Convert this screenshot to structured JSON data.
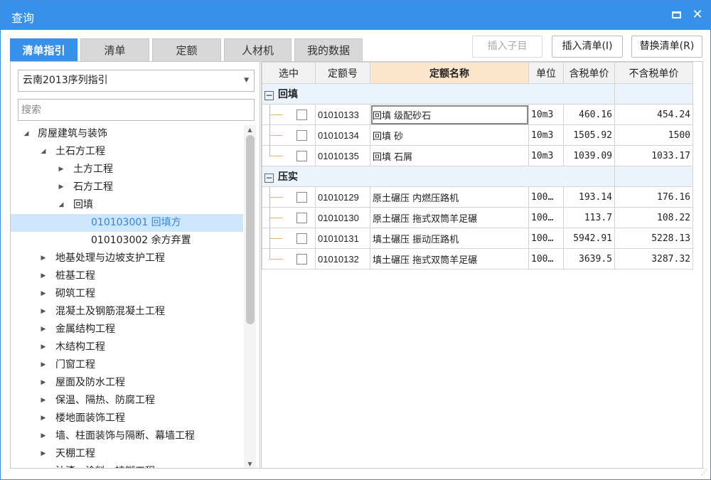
{
  "window": {
    "title": "查询",
    "maximize_icon": "maximize-icon",
    "close_label": "✕"
  },
  "tabs": [
    "清单指引",
    "清单",
    "定额",
    "人材机",
    "我的数据"
  ],
  "buttons": {
    "insert_child": "插入子目",
    "insert_list": "插入清单(I)",
    "replace_list": "替换清单(R)"
  },
  "left": {
    "region_select": "云南2013序列指引",
    "search_placeholder": "搜索",
    "tree": [
      {
        "label": "房屋建筑与装饰",
        "toggle": "◢",
        "level": 0
      },
      {
        "label": "土石方工程",
        "toggle": "◢",
        "level": 1
      },
      {
        "label": "土方工程",
        "toggle": "▶",
        "level": 2
      },
      {
        "label": "石方工程",
        "toggle": "▶",
        "level": 2
      },
      {
        "label": "回填",
        "toggle": "◢",
        "level": 2
      },
      {
        "label": "010103001  回填方",
        "toggle": "",
        "level": 3,
        "selected": true
      },
      {
        "label": "010103002  余方弃置",
        "toggle": "",
        "level": 3
      },
      {
        "label": "地基处理与边坡支护工程",
        "toggle": "▶",
        "level": 1
      },
      {
        "label": "桩基工程",
        "toggle": "▶",
        "level": 1
      },
      {
        "label": "砌筑工程",
        "toggle": "▶",
        "level": 1
      },
      {
        "label": "混凝土及钢筋混凝土工程",
        "toggle": "▶",
        "level": 1
      },
      {
        "label": "金属结构工程",
        "toggle": "▶",
        "level": 1
      },
      {
        "label": "木结构工程",
        "toggle": "▶",
        "level": 1
      },
      {
        "label": "门窗工程",
        "toggle": "▶",
        "level": 1
      },
      {
        "label": "屋面及防水工程",
        "toggle": "▶",
        "level": 1
      },
      {
        "label": "保温、隔热、防腐工程",
        "toggle": "▶",
        "level": 1
      },
      {
        "label": "楼地面装饰工程",
        "toggle": "▶",
        "level": 1
      },
      {
        "label": "墙、柱面装饰与隔断、幕墙工程",
        "toggle": "▶",
        "level": 1
      },
      {
        "label": "天棚工程",
        "toggle": "▶",
        "level": 1
      },
      {
        "label": "油漆、涂料、裱糊工程",
        "toggle": "▶",
        "level": 1
      }
    ]
  },
  "grid": {
    "columns": [
      "选中",
      "定额号",
      "定额名称",
      "单位",
      "含税单价",
      "不含税单价"
    ],
    "groups": [
      {
        "label": "回填",
        "toggle": "−",
        "rows": [
          {
            "code": "01010133",
            "name": "回填  级配砂石",
            "unit": "10m3",
            "price_tax": "460.16",
            "price_notax": "454.24"
          },
          {
            "code": "01010134",
            "name": "回填  砂",
            "unit": "10m3",
            "price_tax": "1505.92",
            "price_notax": "1500"
          },
          {
            "code": "01010135",
            "name": "回填  石屑",
            "unit": "10m3",
            "price_tax": "1039.09",
            "price_notax": "1033.17"
          }
        ]
      },
      {
        "label": "压实",
        "toggle": "−",
        "rows": [
          {
            "code": "01010129",
            "name": "原土碾压  内燃压路机",
            "unit": "100…",
            "price_tax": "193.14",
            "price_notax": "176.16"
          },
          {
            "code": "01010130",
            "name": "原土碾压  拖式双筒羊足碾",
            "unit": "100…",
            "price_tax": "113.7",
            "price_notax": "108.22"
          },
          {
            "code": "01010131",
            "name": "填土碾压  振动压路机",
            "unit": "100…",
            "price_tax": "5942.91",
            "price_notax": "5228.13"
          },
          {
            "code": "01010132",
            "name": "填土碾压  拖式双筒羊足碾",
            "unit": "100…",
            "price_tax": "3639.5",
            "price_notax": "3287.32"
          }
        ]
      }
    ]
  },
  "colors": {
    "accent": "#3790e9",
    "selected_bg": "#cde6fb",
    "header_highlight": "#fde5cc",
    "group_bg": "#ebf4fc"
  }
}
